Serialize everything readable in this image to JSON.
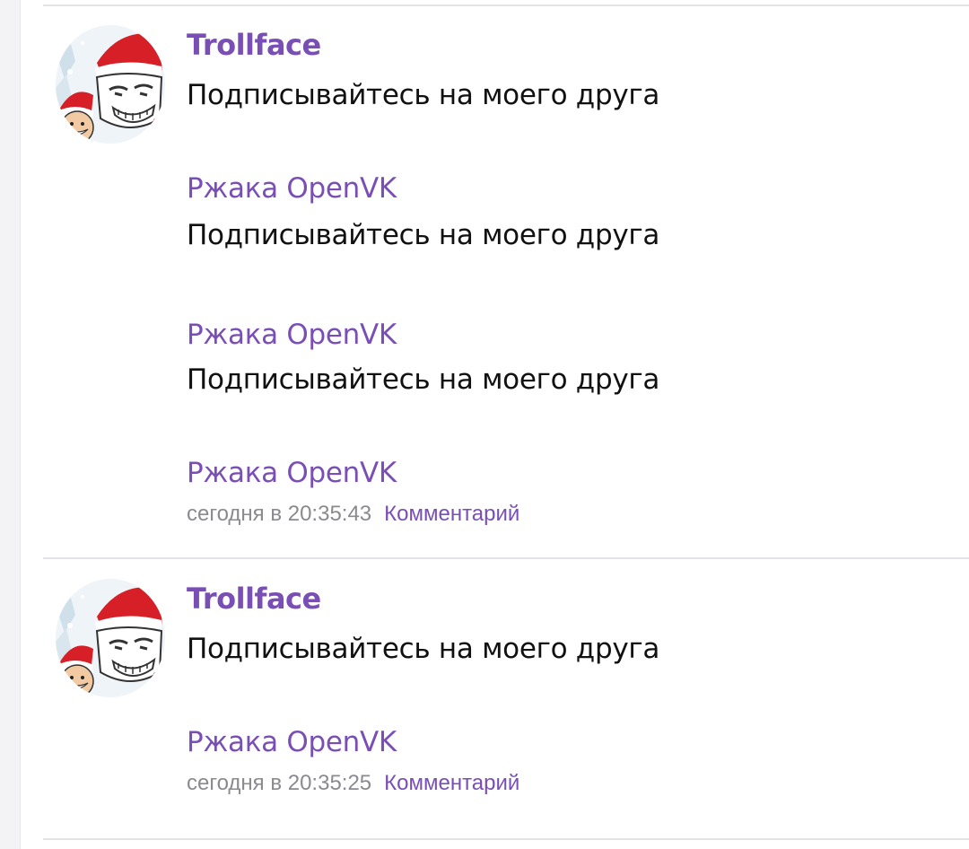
{
  "posts": [
    {
      "author": "Trollface",
      "lines": [
        {
          "text": "Подписывайтесь на моего друга",
          "link": "Ржака OpenVK"
        },
        {
          "text": "Подписывайтесь на моего друга",
          "link": "Ржака OpenVK"
        },
        {
          "text": "Подписывайтесь на моего друга",
          "link": "Ржака OpenVK"
        }
      ],
      "date": "сегодня в 20:35:43",
      "comment_label": "Комментарий"
    },
    {
      "author": "Trollface",
      "lines": [
        {
          "text": "Подписывайтесь на моего друга",
          "link": "Ржака OpenVK"
        }
      ],
      "date": "сегодня в 20:35:25",
      "comment_label": "Комментарий"
    }
  ],
  "colors": {
    "accent": "#7a4fb5",
    "text": "#111111",
    "muted": "#8a8a8f",
    "separator": "#e3e3e7"
  },
  "icons": {
    "avatar": "trollface-santa-avatar"
  }
}
